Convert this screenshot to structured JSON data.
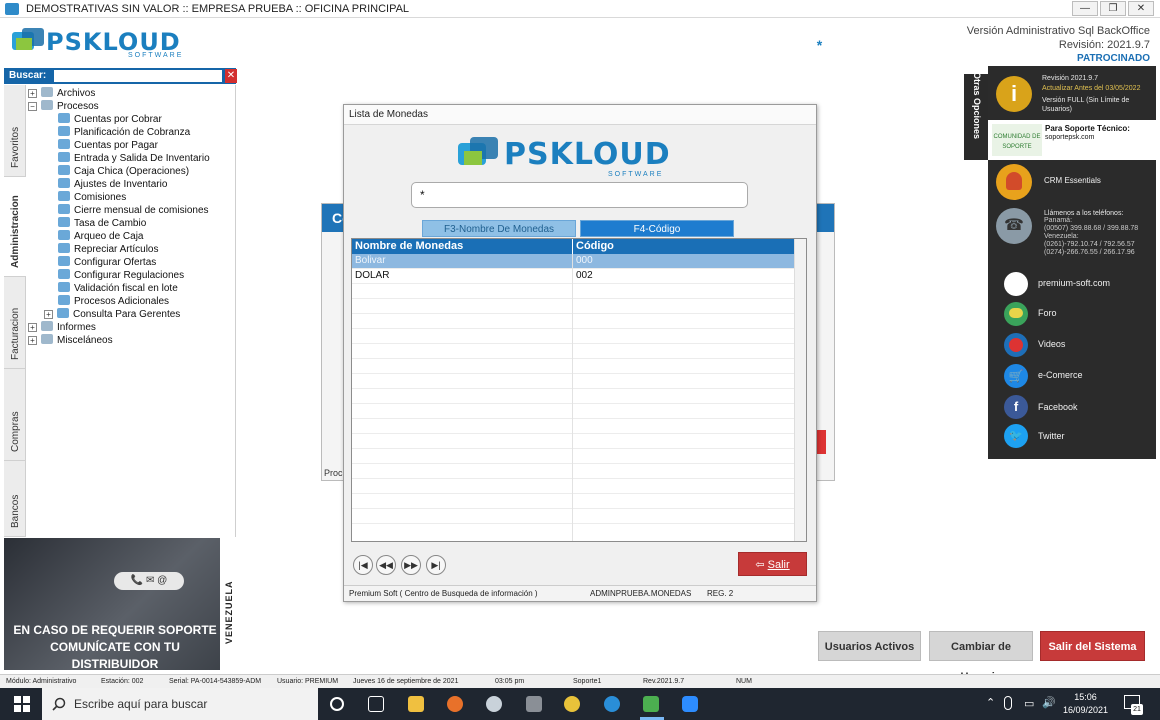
{
  "window": {
    "title": "DEMOSTRATIVAS SIN VALOR :: EMPRESA PRUEBA :: OFICINA PRINCIPAL",
    "minimize": "—",
    "maximize": "❐",
    "close": "✕"
  },
  "header": {
    "logo_text": "PSKLOUD",
    "logo_sub": "SOFTWARE",
    "version_line": "Versión Administrativo Sql BackOffice",
    "revision": "Revisión: 2021.9.7",
    "asterisk": "*",
    "sponsored": "PATROCINADO"
  },
  "sidebar": {
    "search_label": "Buscar:",
    "search_value": "",
    "clear": "✕",
    "tabs": [
      "Favoritos",
      "Administracion",
      "Facturacion",
      "Compras",
      "Bancos"
    ],
    "active_tab": "Administracion",
    "tree": [
      {
        "label": "Archivos",
        "level": 0,
        "toggle": "+"
      },
      {
        "label": "Procesos",
        "level": 0,
        "toggle": "−"
      },
      {
        "label": "Cuentas por Cobrar",
        "level": 1
      },
      {
        "label": "Planificación de Cobranza",
        "level": 1
      },
      {
        "label": "Cuentas por Pagar",
        "level": 1
      },
      {
        "label": "Entrada y Salida De Inventario",
        "level": 1
      },
      {
        "label": "Caja Chica (Operaciones)",
        "level": 1
      },
      {
        "label": "Ajustes de Inventario",
        "level": 1
      },
      {
        "label": "Comisiones",
        "level": 1
      },
      {
        "label": "Cierre mensual de comisiones",
        "level": 1
      },
      {
        "label": "Tasa de Cambio",
        "level": 1
      },
      {
        "label": "Arqueo de Caja",
        "level": 1
      },
      {
        "label": "Repreciar Artículos",
        "level": 1
      },
      {
        "label": "Configurar Ofertas",
        "level": 1
      },
      {
        "label": "Configurar Regulaciones",
        "level": 1
      },
      {
        "label": "Validación fiscal en lote",
        "level": 1
      },
      {
        "label": "Procesos Adicionales",
        "level": 1
      },
      {
        "label": "Consulta Para Gerentes",
        "level": 1,
        "toggle": "+"
      },
      {
        "label": "Informes",
        "level": 0,
        "toggle": "+"
      },
      {
        "label": "Misceláneos",
        "level": 0,
        "toggle": "+"
      }
    ],
    "banner": {
      "line1": "EN CASO DE REQUERIR SOPORTE",
      "line2": "COMUNÍCATE CON TU DISTRIBUIDOR",
      "side": "VENEZUELA",
      "icons": "📞 ✉ @"
    }
  },
  "background_form": {
    "title_fragment": "Co",
    "footer_fragment": "Proc"
  },
  "dialog": {
    "title": "Lista de Monedas",
    "search_value": "*",
    "tab_f3": "F3-Nombre De Monedas",
    "tab_f4": "F4-Código",
    "columns": [
      "Nombre de Monedas",
      "Código"
    ],
    "rows": [
      {
        "name": "Bolivar",
        "code": "000",
        "selected": true
      },
      {
        "name": "DOLAR",
        "code": "002",
        "selected": false
      }
    ],
    "nav": [
      "|◀",
      "◀◀",
      "▶▶",
      "▶|"
    ],
    "exit_label": "Salir",
    "exit_icon": "⇦",
    "status": {
      "center": "Premium Soft ( Centro de Busqueda de información )",
      "table": "ADMINPRUEBA.MONEDAS",
      "reg": "REG. 2"
    }
  },
  "right_panel": {
    "tab_label": "Otras Opciones",
    "revision": "Revisión 2021.9.7",
    "update_before": "Actualizar Antes del 03/05/2022",
    "full_version": "Versión FULL (Sin Límite de Usuarios)",
    "support_title": "Para Soporte Técnico:",
    "support_email": "soportepsk.com",
    "community": "COMUNIDAD DE SOPORTE",
    "crm": "CRM Essentials",
    "phones_title": "Llámenos a los teléfonos:",
    "phones": [
      "Panamá:",
      "(00507) 399.88.68 / 399.88.78",
      "Venezuela:",
      "(0261)-792.10.74 / 792.56.57",
      "(0274)-266.76.55 / 266.17.96"
    ],
    "links": [
      "premium-soft.com",
      "Foro",
      "Videos",
      "e-Comerce",
      "Facebook",
      "Twitter"
    ],
    "colors": {
      "info": "#d9a31a",
      "crm": "#e8a21c",
      "phone": "#8a9aa6",
      "foro": "#3aa35b",
      "videos": "#d33",
      "ecom": "#1e88e5",
      "facebook": "#3b5998",
      "twitter": "#1da1f2"
    }
  },
  "bottom_buttons": {
    "active_users": "Usuarios Activos",
    "change_user": "Cambiar de Usuario",
    "exit_system": "Salir del Sistema"
  },
  "statusbar": {
    "module": "Módulo: Administrativo",
    "station": "Estación:  002",
    "serial": "Serial: PA-0014-543859-ADM",
    "user": "Usuario: PREMIUM",
    "date": "Jueves 16 de septiembre de 2021",
    "time": "03:05 pm",
    "support": "Soporte1",
    "rev": "Rev.2021.9.7",
    "num": "NUM"
  },
  "taskbar": {
    "search_placeholder": "Escribe aquí para buscar",
    "time": "15:06",
    "date": "16/09/2021",
    "notif_count": "21"
  }
}
